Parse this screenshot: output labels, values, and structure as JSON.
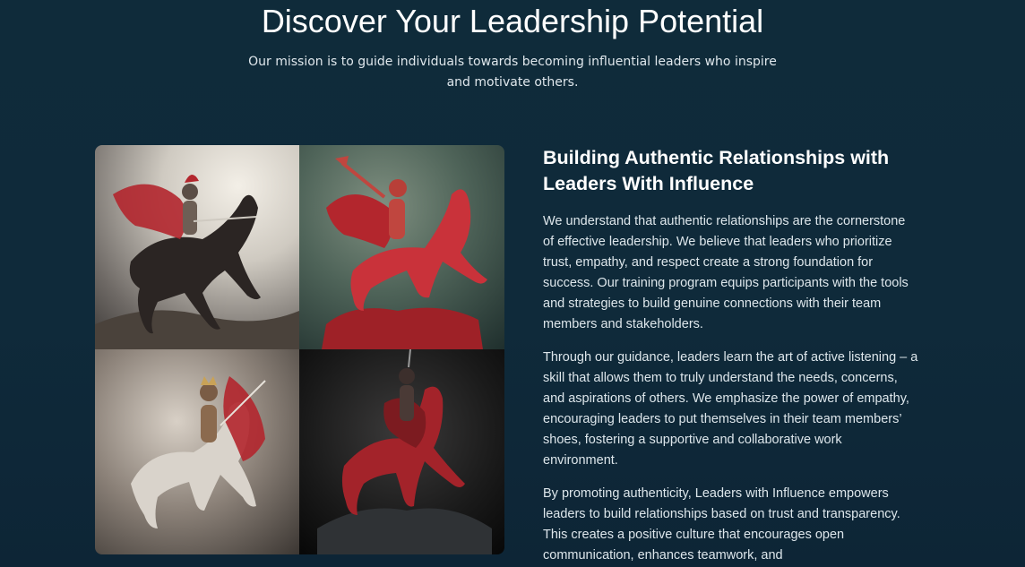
{
  "hero": {
    "title": "Discover Your Leadership Potential",
    "subtitle": "Our mission is to guide individuals towards becoming influential leaders who inspire and motivate others."
  },
  "section": {
    "title": "Building Authentic Relationships with Leaders With Influence",
    "paragraphs": [
      "We understand that authentic relationships are the cornerstone of effective leadership. We believe that leaders who prioritize trust, empathy, and respect create a strong foundation for success. Our training program equips participants with the tools and strategies to build genuine connections with their team members and stakeholders.",
      "Through our guidance, leaders learn the art of active listening – a skill that allows them to truly understand the needs, concerns, and aspirations of others. We emphasize the power of empathy, encouraging leaders to put themselves in their team members’ shoes, fostering a supportive and collaborative work environment.",
      "By promoting authenticity, Leaders with Influence empowers leaders to build relationships based on trust and transparency. This creates a positive culture that encourages open communication, enhances teamwork, and"
    ]
  },
  "image": {
    "icon": "knight-on-horse-collage-image",
    "colors": {
      "background": "#0f2a3a",
      "accent_red": "#b3262d"
    }
  }
}
